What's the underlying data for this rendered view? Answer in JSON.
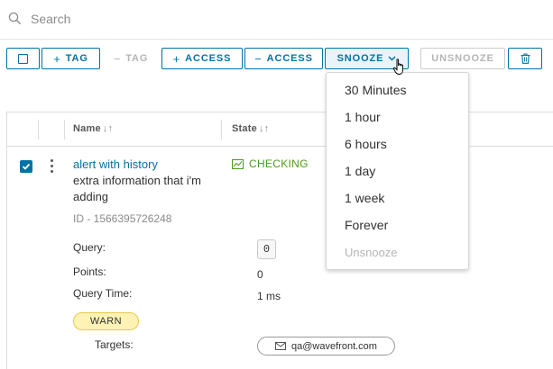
{
  "search": {
    "placeholder": "Search"
  },
  "toolbar": {
    "tag_label": "TAG",
    "untag_label": "TAG",
    "add_access_label": "ACCESS",
    "remove_access_label": "ACCESS",
    "snooze_label": "SNOOZE",
    "unsnooze_label": "UNSNOOZE"
  },
  "table": {
    "columns": [
      {
        "label": "Name"
      },
      {
        "label": "State"
      }
    ],
    "rows": [
      {
        "name": "alert with history",
        "description": "extra information that i'm adding",
        "id": "ID - 1566395726248",
        "state": "CHECKING",
        "query_label": "Query:",
        "query_value": "0",
        "points_label": "Points:",
        "points_value": "0",
        "query_time_label": "Query Time:",
        "query_time_value": "1 ms",
        "severity": "WARN",
        "targets_label": "Targets:",
        "target": "qa@wavefront.com"
      }
    ]
  },
  "snooze_menu": {
    "items": [
      {
        "label": "30 Minutes",
        "enabled": true
      },
      {
        "label": "1 hour",
        "enabled": true
      },
      {
        "label": "6 hours",
        "enabled": true
      },
      {
        "label": "1 day",
        "enabled": true
      },
      {
        "label": "1 week",
        "enabled": true
      },
      {
        "label": "Forever",
        "enabled": true
      },
      {
        "label": "Unsnooze",
        "enabled": false
      }
    ]
  },
  "colors": {
    "primary": "#0072a3",
    "checking": "#4a9a1c",
    "warn_bg": "#fef3b5",
    "warn_border": "#e8c94a",
    "disabled": "#b5b5b5"
  },
  "icons": [
    "search-icon",
    "plus-icon",
    "minus-icon",
    "chevron-down-icon",
    "trash-icon",
    "sort-icon",
    "checkmark-icon",
    "kebab-icon",
    "chart-icon",
    "email-icon",
    "hand-cursor-icon"
  ]
}
